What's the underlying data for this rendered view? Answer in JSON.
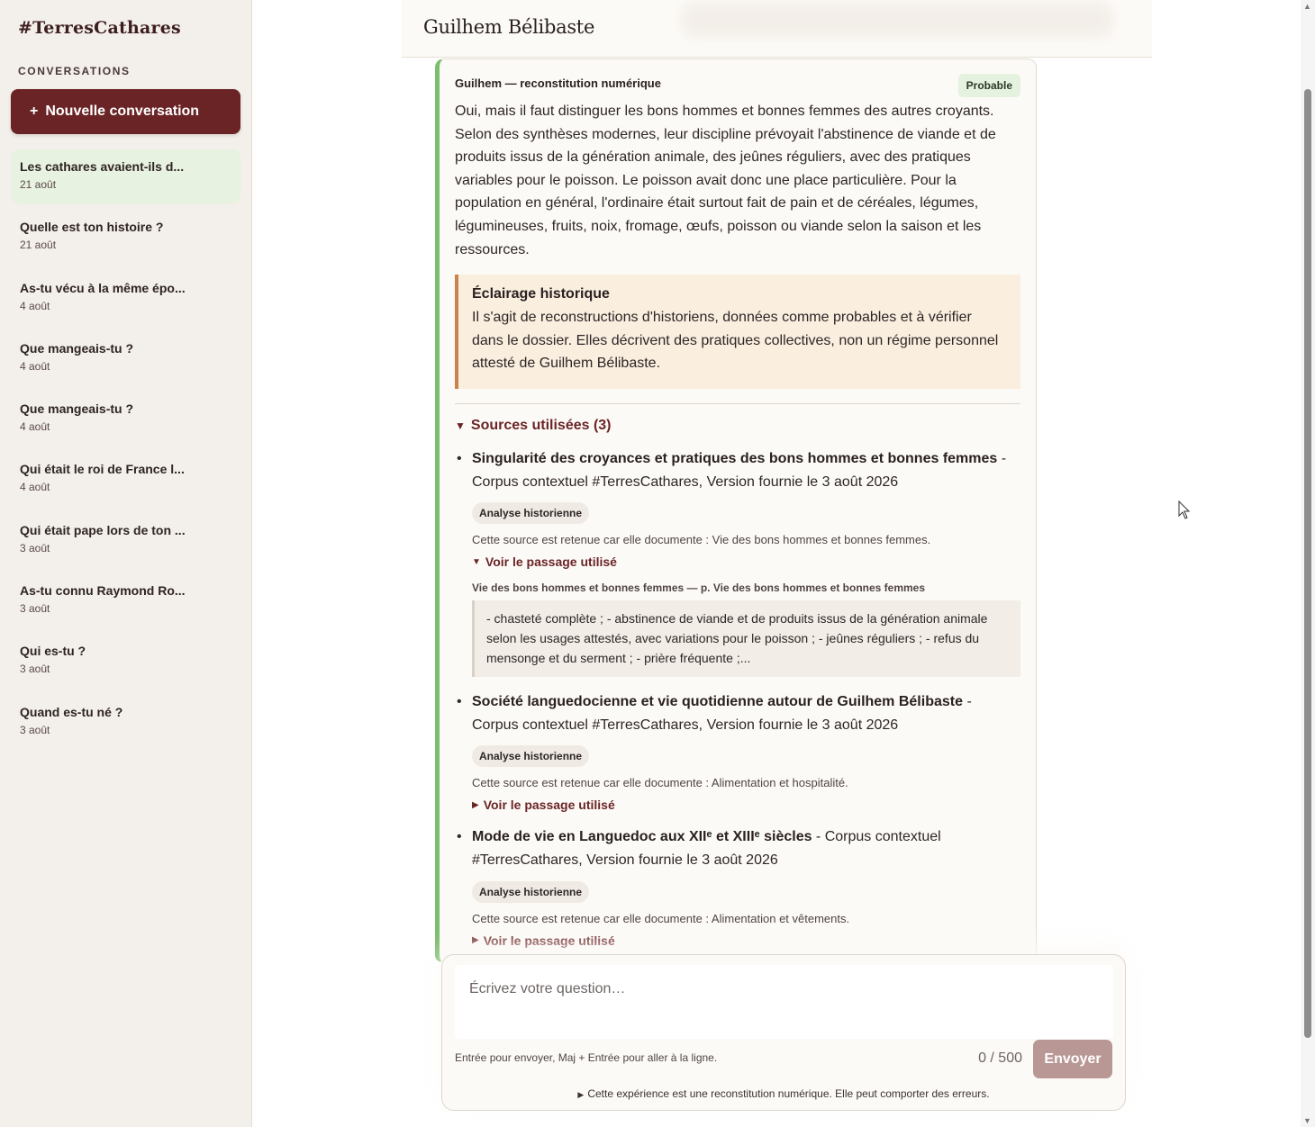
{
  "sidebar": {
    "brand": "#TerresCathares",
    "section_title": "CONVERSATIONS",
    "new_button": {
      "icon": "+",
      "label": "Nouvelle conversation"
    },
    "conversations": [
      {
        "title": "Les cathares avaient-ils d...",
        "date": "21 août",
        "active": true
      },
      {
        "title": "Quelle est ton histoire ?",
        "date": "21 août"
      },
      {
        "title": "As-tu vécu à la même épo...",
        "date": "4 août"
      },
      {
        "title": "Que mangeais-tu ?",
        "date": "4 août"
      },
      {
        "title": "Que mangeais-tu ?",
        "date": "4 août"
      },
      {
        "title": "Qui était le roi de France l...",
        "date": "4 août"
      },
      {
        "title": "Qui était pape lors de ton ...",
        "date": "3 août"
      },
      {
        "title": "As-tu connu Raymond Ro...",
        "date": "3 août"
      },
      {
        "title": "Qui es-tu ?",
        "date": "3 août"
      },
      {
        "title": "Quand es-tu né ?",
        "date": "3 août"
      }
    ]
  },
  "header": {
    "title": "Guilhem Bélibaste"
  },
  "message": {
    "speaker": "Guilhem — reconstitution numérique",
    "badge": "Probable",
    "answer": "Oui, mais il faut distinguer les bons hommes et bonnes femmes des autres croyants. Selon des synthèses modernes, leur discipline prévoyait l'abstinence de viande et de produits issus de la génération animale, des jeûnes réguliers, avec des pratiques variables pour le poisson. Le poisson avait donc une place particulière. Pour la population en général, l'ordinaire était surtout fait de pain et de céréales, légumes, légumineuses, fruits, noix, fromage, œufs, poisson ou viande selon la saison et les ressources.",
    "callout": {
      "title": "Éclairage historique",
      "body": "Il s'agit de reconstructions d'historiens, données comme probables et à vérifier dans le dossier. Elles décrivent des pratiques collectives, non un régime personnel attesté de Guilhem Bélibaste."
    },
    "sources_label": "Sources utilisées (3)",
    "sources": [
      {
        "title": "Singularité des croyances et pratiques des bons hommes et bonnes femmes",
        "meta": " - Corpus contextuel #TerresCathares, Version fournie le 3 août 2026",
        "tag": "Analyse historienne",
        "why": "Cette source est retenue car elle documente : Vie des bons hommes et bonnes femmes.",
        "voir": "Voir le passage utilisé",
        "passage_title": "Vie des bons hommes et bonnes femmes — p. Vie des bons hommes et bonnes femmes",
        "passage": "- chasteté complète ; - abstinence de viande et de produits issus de la génération animale selon les usages attestés, avec variations pour le poisson ; - jeûnes réguliers ; - refus du mensonge et du serment ; - prière fréquente ;..."
      },
      {
        "title": "Société languedocienne et vie quotidienne autour de Guilhem Bélibaste",
        "meta": " - Corpus contextuel #TerresCathares, Version fournie le 3 août 2026",
        "tag": "Analyse historienne",
        "why": "Cette source est retenue car elle documente : Alimentation et hospitalité.",
        "voir": "Voir le passage utilisé"
      },
      {
        "title": "Mode de vie en Languedoc aux XIIᵉ et XIIIᵉ siècles",
        "meta": " - Corpus contextuel #TerresCathares, Version fournie le 3 août 2026",
        "tag": "Analyse historienne",
        "why": "Cette source est retenue car elle documente : Alimentation et vêtements.",
        "voir": "Voir le passage utilisé"
      }
    ]
  },
  "composer": {
    "placeholder": "Écrivez votre question…",
    "hint": "Entrée pour envoyer, Maj + Entrée pour aller à la ligne.",
    "counter": "0 / 500",
    "send_label": "Envoyer",
    "disclaimer": "Cette expérience est une reconstitution numérique. Elle peut comporter des erreurs."
  },
  "colors": {
    "brand": "#6b2426",
    "accent_green": "#7cbd6e",
    "callout_border": "#c9844a"
  }
}
